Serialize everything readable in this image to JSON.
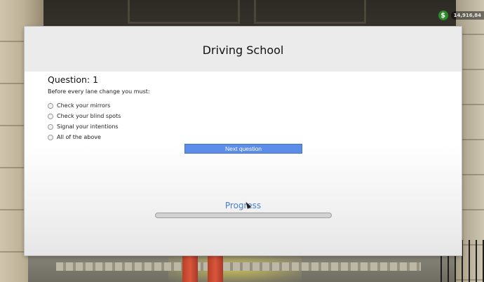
{
  "hud": {
    "money_icon": "$",
    "money": "14,916,84"
  },
  "dialog": {
    "title": "Driving School",
    "question_label": "Question: 1",
    "question_text": "Before every lane change you must:",
    "options": [
      "Check your mirrors",
      "Check your blind spots",
      "Signal your intentions",
      "All of the above"
    ],
    "next_button_label": "Next question",
    "progress_label": "Progress",
    "progress_value": 0
  },
  "colors": {
    "accent": "#5b8de9",
    "progress_text": "#4a7fce",
    "money_green": "#2d8a2b"
  }
}
